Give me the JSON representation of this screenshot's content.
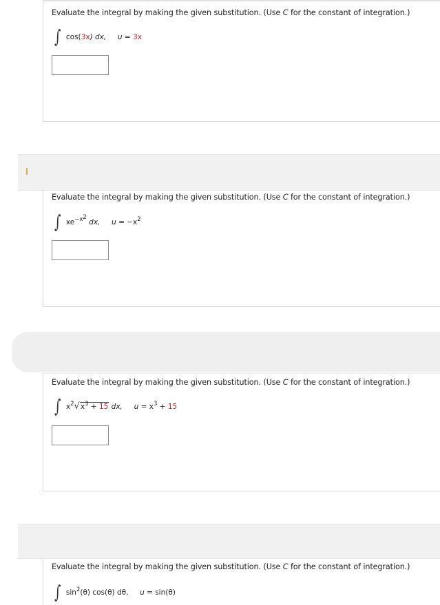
{
  "questions": [
    {
      "prompt_before": "Evaluate the integral by making the given substitution. (Use ",
      "prompt_c": "C",
      "prompt_after": " for the constant of integration.)",
      "integrand": "cos(",
      "integrand_red": "3x",
      "integrand_end": ") dx,",
      "subst_u": "u",
      "subst_eq": " = ",
      "subst_red": "3x",
      "answer_value": ""
    },
    {
      "prompt_before": "Evaluate the integral by making the given substitution. (Use ",
      "prompt_c": "C",
      "prompt_after": " for the constant of integration.)",
      "integrand_base": "xe",
      "integrand_exp": "−x",
      "integrand_exp2": "2",
      "integrand_end": " dx,",
      "subst_u": "u",
      "subst_eq": " = −x",
      "subst_exp": "2",
      "answer_value": ""
    },
    {
      "prompt_before": "Evaluate the integral by making the given substitution. (Use ",
      "prompt_c": "C",
      "prompt_after": " for the constant of integration.)",
      "integrand_x": "x",
      "integrand_xexp": "2",
      "radicand_x": "x",
      "radicand_exp": "3",
      "radicand_plus": " + ",
      "radicand_red": "15",
      "integrand_end": " dx,",
      "subst_u": "u",
      "subst_eq": " = x",
      "subst_exp": "3",
      "subst_plus": " + ",
      "subst_red": "15",
      "answer_value": ""
    },
    {
      "prompt_before": "Evaluate the integral by making the given substitution. (Use ",
      "prompt_c": "C",
      "prompt_after": " for the constant of integration.)",
      "integrand_a": "sin",
      "integrand_aexp": "2",
      "integrand_b": "(θ) cos(θ) dθ,",
      "subst_u": "u",
      "subst_eq": " = sin(θ)"
    }
  ],
  "colors": {
    "accent_red": "#c8201c",
    "border": "#d7d7d7",
    "band": "#f1f1f1"
  },
  "icons": {
    "integral": "∫",
    "sqrt": "√"
  },
  "integral_symbol": "∫",
  "sqrt_symbol": "√"
}
